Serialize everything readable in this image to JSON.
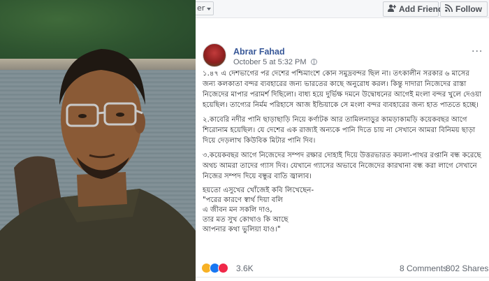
{
  "header": {
    "follow_select_label": "er",
    "add_friend_label": "Add Friend",
    "follow_label": "Follow"
  },
  "post": {
    "author": "Abrar Fahad",
    "timestamp": "October 5 at 5:32 PM",
    "paragraphs": [
      "১.৪৭ এ দেশভাগের পর দেশের পশ্চিমাংশে কোন সমুদ্রবন্দর ছিল না। তৎকালীন সরকার ৬ মাসের জন্য কলকাতা বন্দর ব্যবহারের জন্য ভারতের কাছে অনুরোধ করল। কিন্তু দাদারা নিজেদের রাস্তা নিজেদের মাপার পরামর্শ দিছিলো। বাধ্য হয়ে দুর্ভিক্ষ দমনে উদ্বোধনের আগেই মংলা বন্দর খুলে দেওয়া হয়েছিল। তাগ্যের নির্মম পরিহাসে আজ ইন্ডিয়াকে সে মংলা বন্দর ব্যবহারের জন্য হাত পাততে হচ্ছে।",
      "২.কাবেরি নদীর পানি ছাড়াছাড়ি নিয়ে কর্ণাটক আর তামিলনাড়ুর কামড়াকামড়ি কয়েকবছর আগে শিরোনাম হয়েছিল। যে দেশের এক রাজ্যই অন্যকে পানি দিতে চায় না সেখানে আমরা বিনিময় ছাড়া দিয়ে দেড়লাখ কিউবিক মিটার পানি দিব।",
      "৩.কয়েকবছর আগে নিজেদের সম্পদ রক্ষার দোহাই দিয়ে উত্তরভারত কয়লা-পাথর রপ্তানি বন্ধ করেছে অথচ আমরা তাদের গ্যাস দিব। যেখানে গ্যাসের অভাবে নিজেদের কারখানা বন্ধ করা লাগে সেখানে নিজের সম্পদ দিয়ে বন্ধুর বাতি জ্বালাব।"
    ],
    "poem_intro": "হয়তো এসুখের খোঁজেই কবি লিখেছেন-",
    "poem_lines": [
      "\"পরের কারণে স্বার্থ দিয়া বলি",
      "এ জীবন মন সকলি দাও,",
      "তার মত সুখ কোথাও কি আছে",
      "আপনার কথা ভুলিয়া যাও।\""
    ]
  },
  "engagement": {
    "reaction_count": "3.6K",
    "comments": "8 Comments",
    "shares": "802 Shares"
  },
  "icons": {
    "add_friend": "add-friend-icon",
    "follow": "rss-follow-icon",
    "privacy": "globe-icon",
    "more": "more-options-icon"
  },
  "colors": {
    "link_blue": "#385898",
    "text": "#1c1e21",
    "meta_gray": "#616770"
  }
}
